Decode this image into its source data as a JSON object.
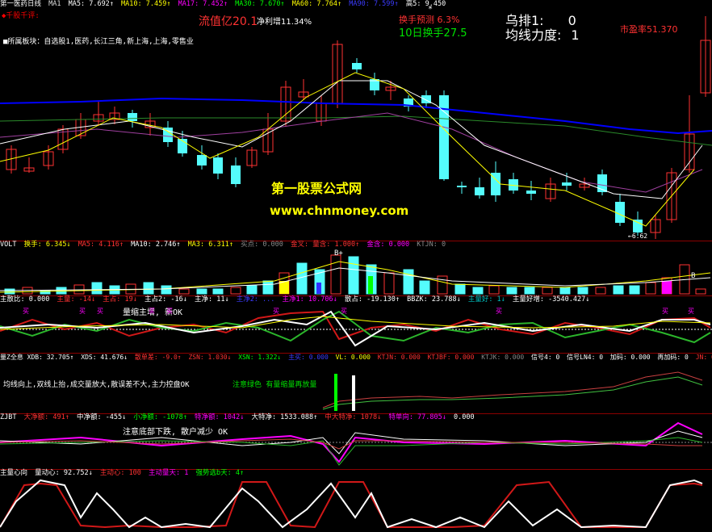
{
  "main": {
    "title": "第一医药日线",
    "ma": [
      "MA1",
      "MA5: 7.692↑",
      "MA10: 7.459↑",
      "MA17: 7.452↑",
      "MA30: 7.670↑",
      "MA60: 7.764↑",
      "MA90: 7.599↑",
      "高5: 9.450"
    ],
    "tag_line": "◆千股千评:",
    "sector_label": "■所属板块：自选股1,医药,长江三角,新上海,上海,零售业",
    "float_cap": "流值亿20.1",
    "net_profit": "净利增11.34%",
    "turnover_forecast": "换手预测 6.3%",
    "turnover_10d": "10日换手27.5",
    "ma_rank": "乌排1:",
    "ma_rank_val": "0",
    "ma_strength": "均线力度:",
    "ma_strength_val": "1",
    "pe": "市盈率51.370",
    "watermark_cn": "第一股票公式网",
    "watermark_url": "www.chnmoney.com",
    "low_label": "←6.62"
  },
  "vol": {
    "hdr": [
      "VOLT",
      "换手: 6.345↓",
      "MA5: 4.116↑",
      "MA10: 2.746↑",
      "MA3: 6.311↑",
      "买点: 0.000",
      "金叉: 量含: 1.000↑",
      "金含: 0.000",
      "KTJN: 0"
    ],
    "markers": [
      "B+",
      "B"
    ]
  },
  "ind1": {
    "hdr": [
      "主散比: 0.000",
      "主量: -14↓",
      "主占: 19↓",
      "主占2: -16↓",
      "主净: 11↓",
      "主净2: ...",
      "主净1: 10.706↓",
      "散占: -19.130↑",
      "BBZK: 23.788↓",
      "主量好: 1↓",
      "主量好增: -3540.427↓"
    ],
    "label": "量缩主增, 新OK",
    "tag": "买"
  },
  "ind2": {
    "hdr": [
      "量Z全息 XDB: 32.705↑",
      "XDS: 41.676↓",
      "散单差: -9.0↑",
      "ZSN: 1.030↓",
      "XSN: 1.322↓",
      "主买: 0.000",
      "VL: 0.000",
      "KTJN: 0.000",
      "KTJBF: 0.000",
      "KTJK: 0.000",
      "信号4: 0",
      "信号LN4: 0",
      "加码: 0.000",
      "再加码: 0",
      "JN: 0.000"
    ],
    "note1": "均线向上,双线上抬,成交量放大,散误差不大,主力控盘OK",
    "note2": "注意绿色 有量缩量再放量"
  },
  "ind3": {
    "hdr": [
      "ZJBT",
      "大净额: 491↑",
      "中净额: -455↓",
      "小净额: -1078↑",
      "特净额: 1042↓",
      "大特净: 1533.088↑",
      "中大特净: 1078↓",
      "特单向: 77.805↓",
      "0.000"
    ],
    "note": "注意底部下跌, 散户减少 OK"
  },
  "ind4": {
    "hdr": [
      "主量心向",
      "量动心: 92.752↓",
      "主动心: 100",
      "主动量天: 1",
      "强势选b天: 4↑"
    ]
  },
  "colors": {
    "up": "#ff3232",
    "down": "#54fcfc",
    "yellow": "#ffff00",
    "white": "#ffffff",
    "magenta": "#ff00ff",
    "green": "#00c000",
    "blue": "#0000ff",
    "red": "#d01818"
  }
}
